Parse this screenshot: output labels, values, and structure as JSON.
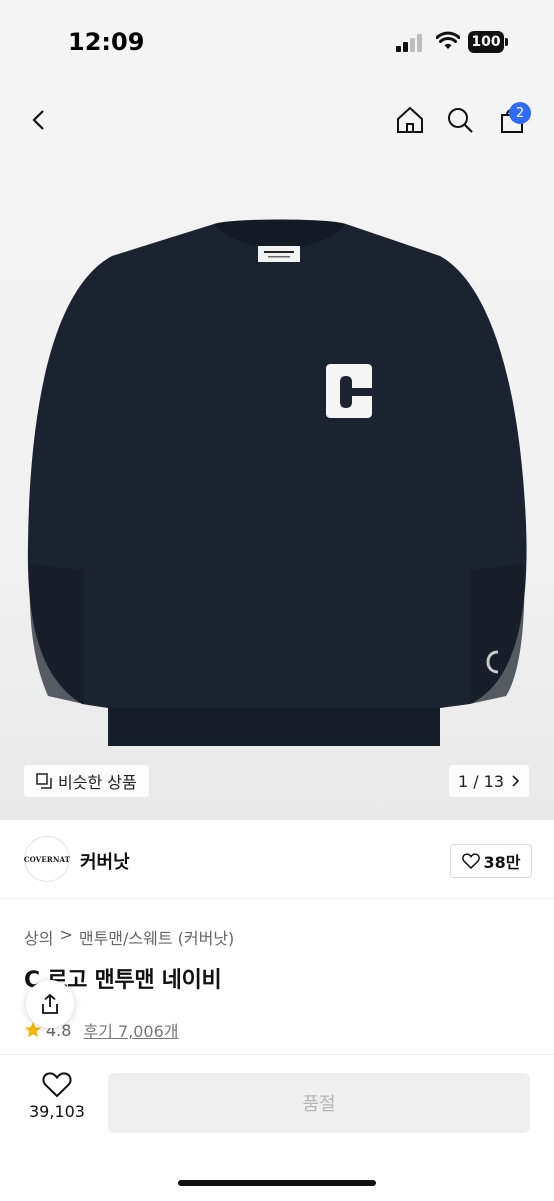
{
  "status": {
    "time": "12:09",
    "battery": "100"
  },
  "nav": {
    "cart_count": "2"
  },
  "gallery": {
    "similar_label": "비슷한 상품",
    "page_indicator": "1 / 13"
  },
  "brand": {
    "logo_text": "COVERNAT",
    "name": "커버낫",
    "like_count": "38만"
  },
  "product": {
    "breadcrumb": [
      "상의",
      "맨투맨/스웨트 (커버낫)"
    ],
    "title": "C 로고 맨투맨 네이비",
    "rating": "4.8",
    "reviews": "후기 7,006개"
  },
  "bottom": {
    "wish_count": "39,103",
    "cta_label": "품절"
  },
  "colors": {
    "accent": "#2f6bff",
    "navy": "#1b2330",
    "soldout_bg": "#efefef"
  },
  "icons": [
    "back-icon",
    "home-icon",
    "search-icon",
    "cart-icon",
    "similar-icon",
    "chevron-right-icon",
    "heart-icon",
    "share-icon",
    "star-icon"
  ]
}
